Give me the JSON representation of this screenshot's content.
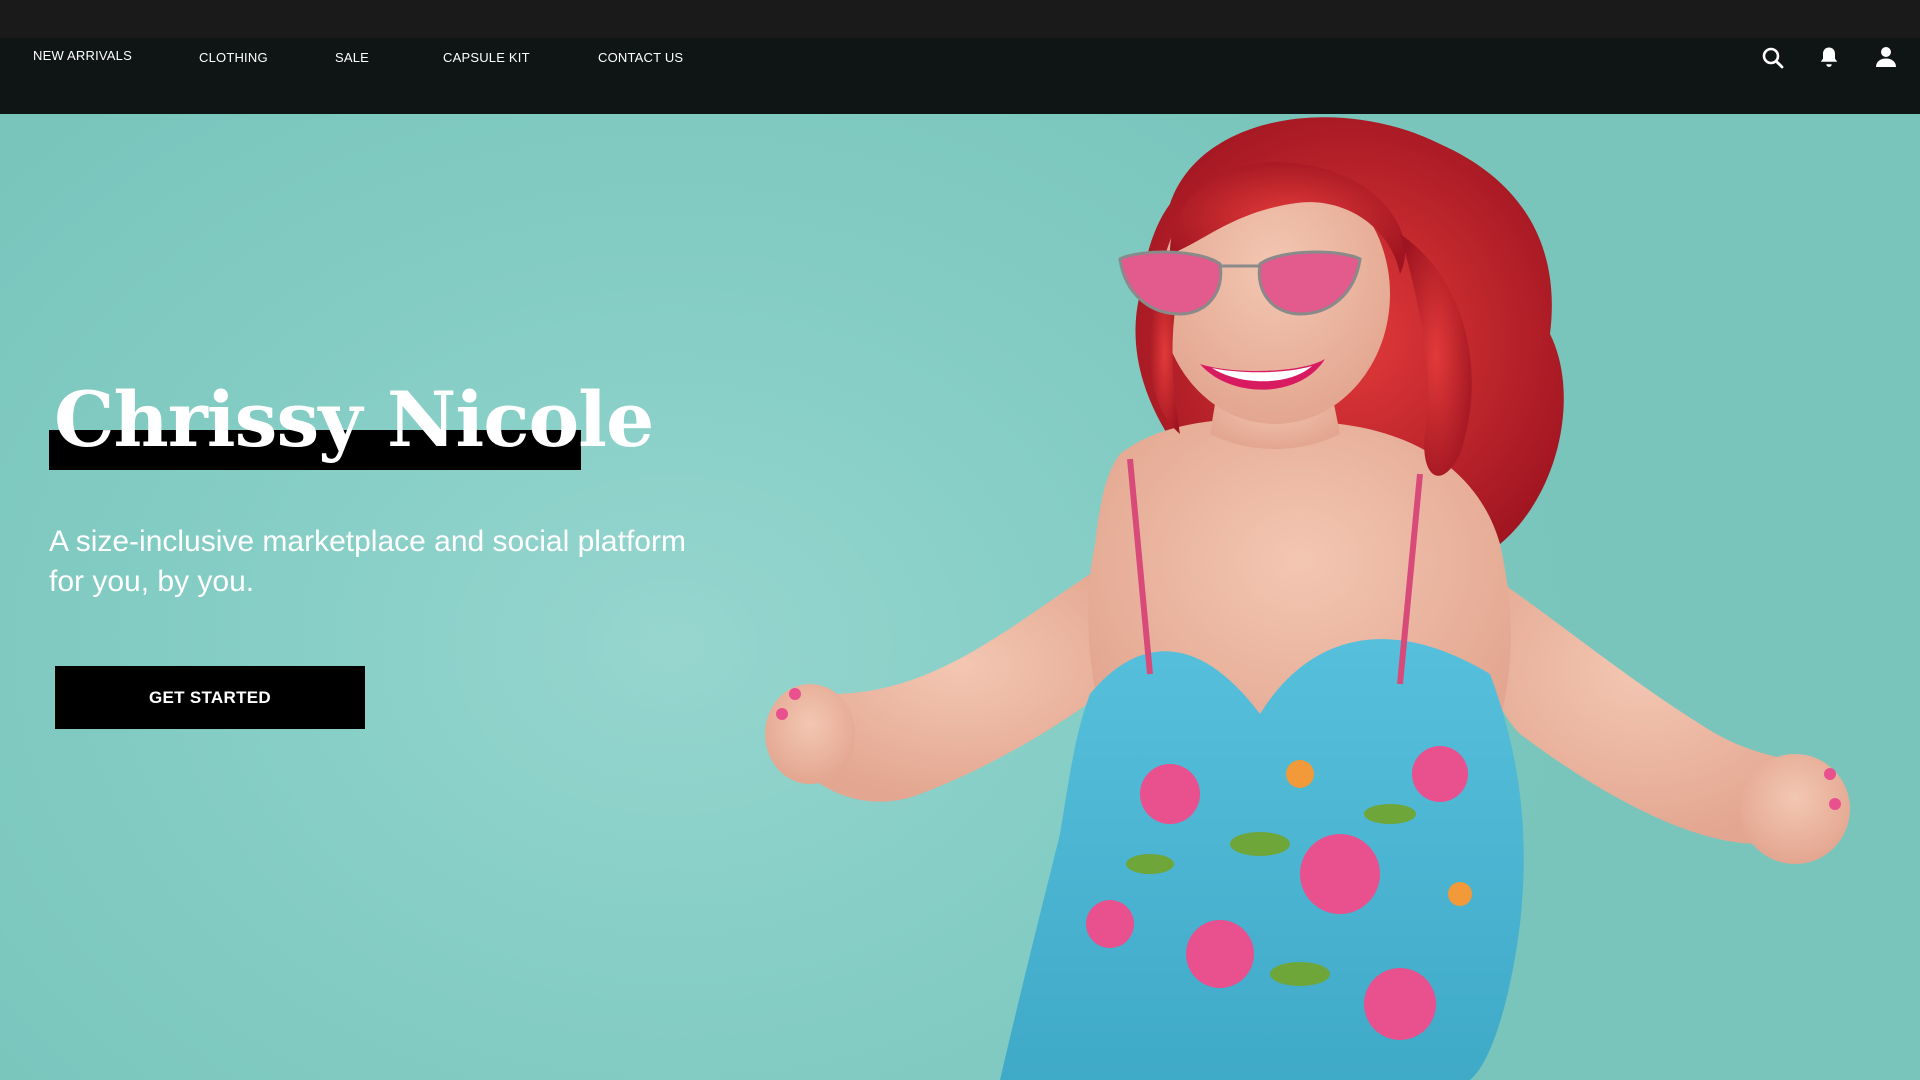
{
  "nav": {
    "items": [
      {
        "label": "NEW ARRIVALS"
      },
      {
        "label": "CLOTHING"
      },
      {
        "label": "SALE"
      },
      {
        "label": "CAPSULE KIT"
      },
      {
        "label": "CONTACT US"
      }
    ],
    "icons": [
      "search-icon",
      "bell-icon",
      "user-icon"
    ]
  },
  "hero": {
    "title": "Chrissy Nicole",
    "tagline_line1": "A size-inclusive marketplace and social platform",
    "tagline_line2": "for you, by you.",
    "cta_label": "GET STARTED"
  },
  "colors": {
    "topbar": "#1a1a1a",
    "navbar": "#0f1414",
    "hero_background": "#86cec6",
    "title_bar": "#000000",
    "cta_background": "#000000",
    "text": "#ffffff",
    "hair": "#c8202a",
    "dress": "#4fb8d6"
  }
}
